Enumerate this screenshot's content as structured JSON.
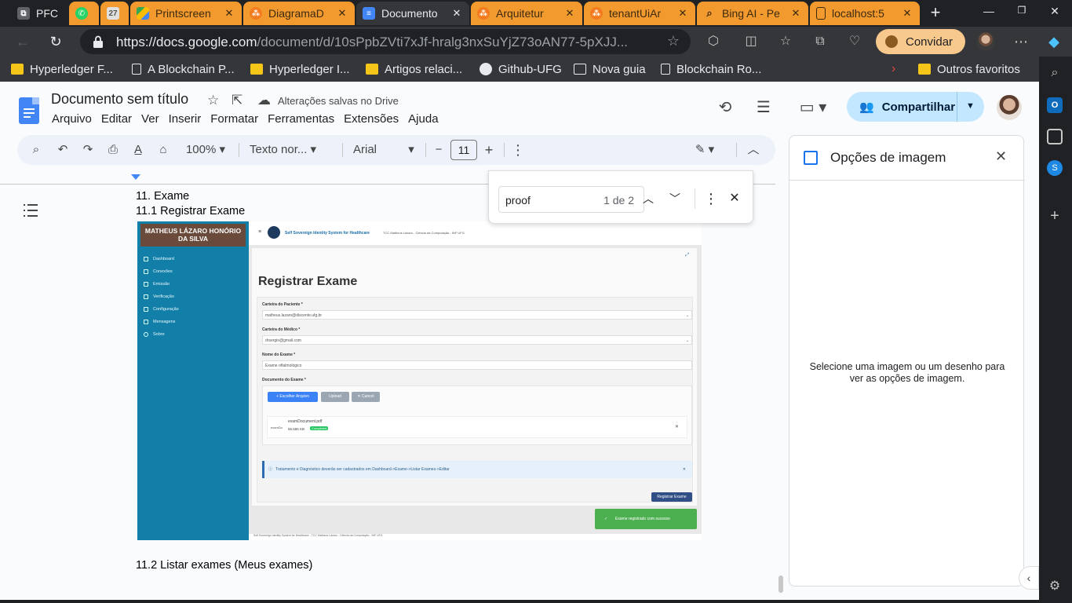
{
  "tabs": [
    {
      "label": "PFC",
      "close": ""
    },
    {
      "label": "",
      "close": ""
    },
    {
      "label": "",
      "close": ""
    },
    {
      "label": "Printscreen",
      "close": "✕"
    },
    {
      "label": "DiagramaD",
      "close": "✕"
    },
    {
      "label": "Documento",
      "close": "✕"
    },
    {
      "label": "Arquitetur",
      "close": "✕"
    },
    {
      "label": "tenantUiAr",
      "close": "✕"
    },
    {
      "label": "Bing AI - Pe",
      "close": "✕"
    },
    {
      "label": "localhost:5",
      "close": "✕"
    }
  ],
  "address": {
    "url_host": "https://docs.google.com",
    "url_path": "/document/d/10sPpbZVti7xJf-hralg3nxSuYjZ73oAN77-5pXJJ...",
    "invite_label": "Convidar"
  },
  "bookmarks": [
    "Hyperledger F...",
    "A Blockchain P...",
    "Hyperledger I...",
    "Artigos relaci...",
    "Github-UFG",
    "Nova guia",
    "Blockchain Ro...",
    "Outros favoritos"
  ],
  "docs": {
    "title": "Documento sem título",
    "saved_status": "Alterações salvas no Drive",
    "menu": [
      "Arquivo",
      "Editar",
      "Ver",
      "Inserir",
      "Formatar",
      "Ferramentas",
      "Extensões",
      "Ajuda"
    ],
    "share_label": "Compartilhar",
    "zoom": "100%",
    "style": "Texto nor...",
    "font": "Arial",
    "font_size": "11"
  },
  "find": {
    "query": "proof",
    "count": "1 de 2"
  },
  "content": {
    "line1": "11. Exame",
    "line2": "11.1 Registrar Exame",
    "line3": "11.2 Listar exames (Meus exames)"
  },
  "screenshot": {
    "user_name": "MATHEUS LÁZARO HONÓRIO DA SILVA",
    "sidebar": [
      "Dashboard",
      "Conexões",
      "Emissão",
      "Verificação",
      "Configuração",
      "Mensagens",
      "Sobre"
    ],
    "app_title": "Self Sovereign Identity System for Healthcare",
    "app_subtitle": "TCC Matheus Lázaro - Ciência da Computação - INF UFG",
    "page_title": "Registrar Exame",
    "f1_label": "Carteira do Paciente *",
    "f1_value": "matheus.lazaro@discente.ufg.br",
    "f2_label": "Carteira do Médico *",
    "f2_value": "drsergio@gmail.com",
    "f3_label": "Nome do Exame *",
    "f3_value": "Exame oftalmológico",
    "f4_label": "Documento do Exame *",
    "btn_choose": "+ Escolher Arquivo",
    "btn_upload": "Upload",
    "btn_cancel": "✕ Cancel",
    "file_name": "examDocument.pdf",
    "file_size": "56.565 KB",
    "file_status": "Completed",
    "file_thumb": "examDo",
    "info": "Tratamento e Diagnóstico deverão ser cadastrados em Dashboard->Exame->Listar Exames->Editar",
    "submit": "Registrar Exame",
    "toast": "Exame registrado com sucesso",
    "footer": "Self Sovereign Identity System for Healthcare - TCC Matheus Lázaro - Ciência da Computação - INF UFG"
  },
  "image_options": {
    "title": "Opções de imagem",
    "message": "Selecione uma imagem ou um desenho para ver as opções de imagem."
  },
  "colors": {
    "accent": "#1a73e8",
    "share_bg": "#c2e7ff",
    "sidebar_teal": "#127fa8",
    "toast_green": "#4caf50"
  }
}
